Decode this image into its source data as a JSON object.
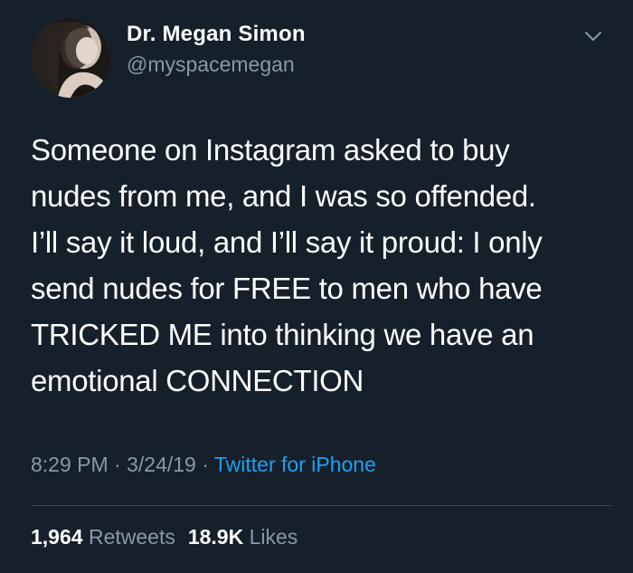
{
  "author": {
    "name": "Dr. Megan Simon",
    "handle": "@myspacemegan"
  },
  "tweet": {
    "lines": [
      "Someone on Instagram asked to buy",
      "nudes from me, and I was so offended.",
      "I’ll say it loud, and I’ll say it proud: I only",
      "send nudes for FREE to men who have",
      "TRICKED ME into thinking we have an",
      "emotional CONNECTION"
    ]
  },
  "meta": {
    "time": "8:29 PM",
    "separator": " · ",
    "date": "3/24/19",
    "source": "Twitter for iPhone"
  },
  "stats": {
    "retweets_count": "1,964",
    "retweets_label": "Retweets",
    "likes_count": "18.9K",
    "likes_label": "Likes"
  },
  "icons": {
    "menu": "chevron-down-icon"
  },
  "colors": {
    "background": "#15202b",
    "text": "#ffffff",
    "secondary": "#8899a6",
    "accent": "#1da1f2",
    "divider": "#38444d"
  }
}
